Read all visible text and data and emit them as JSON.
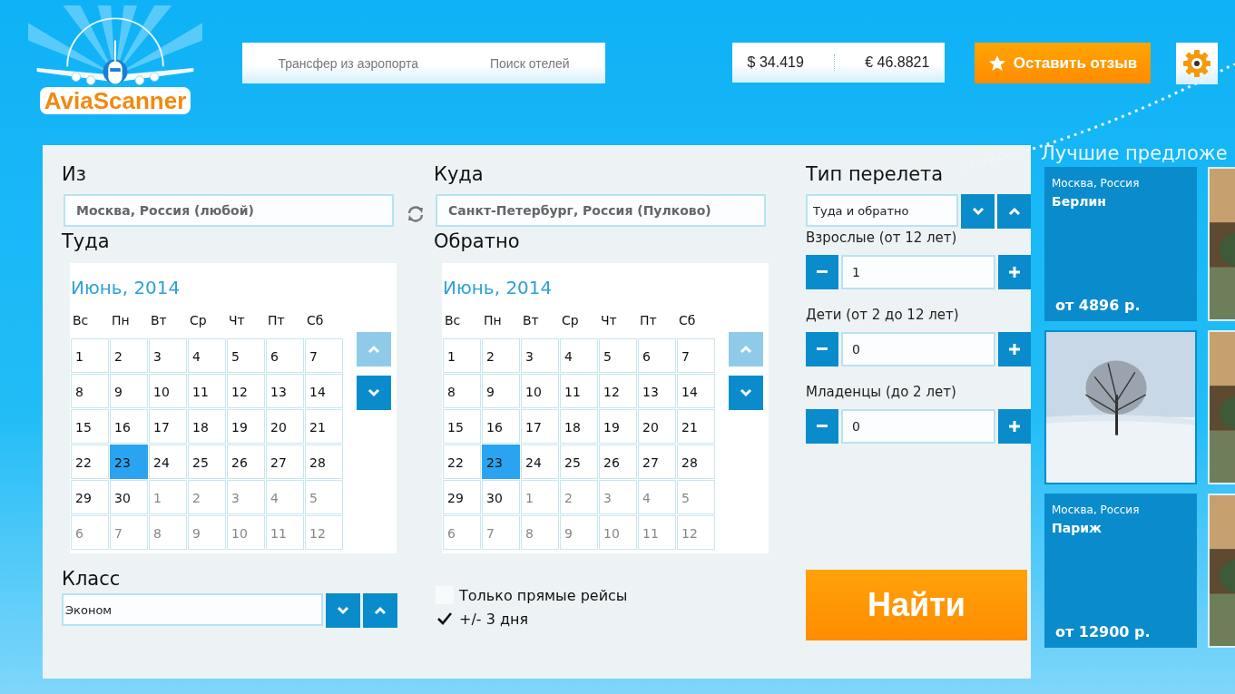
{
  "logo": {
    "text": "AviaScanner"
  },
  "nav_links": [
    "Трансфер из аэропорта",
    "Поиск отелей"
  ],
  "rates": [
    "$ 34.419",
    "€ 46.8821"
  ],
  "feedback_button": "Оставить отзыв",
  "form": {
    "from": {
      "label": "Из",
      "value": "Москва, Россия (любой)"
    },
    "to": {
      "label": "Куда",
      "value": "Санкт-Петербург, Россия (Пулково)"
    },
    "calendars": [
      {
        "label": "Туда",
        "month": "Июнь, 2014",
        "weekdays": [
          "Вс",
          "Пн",
          "Вт",
          "Ср",
          "Чт",
          "Пт",
          "Сб"
        ],
        "up_disabled": true,
        "down_disabled": false,
        "days": [
          {
            "day": "1",
            "muted": false,
            "selected": false
          },
          {
            "day": "2",
            "muted": false,
            "selected": false
          },
          {
            "day": "3",
            "muted": false,
            "selected": false
          },
          {
            "day": "4",
            "muted": false,
            "selected": false
          },
          {
            "day": "5",
            "muted": false,
            "selected": false
          },
          {
            "day": "6",
            "muted": false,
            "selected": false
          },
          {
            "day": "7",
            "muted": false,
            "selected": false
          },
          {
            "day": "8",
            "muted": false,
            "selected": false
          },
          {
            "day": "9",
            "muted": false,
            "selected": false
          },
          {
            "day": "10",
            "muted": false,
            "selected": false
          },
          {
            "day": "11",
            "muted": false,
            "selected": false
          },
          {
            "day": "12",
            "muted": false,
            "selected": false
          },
          {
            "day": "13",
            "muted": false,
            "selected": false
          },
          {
            "day": "14",
            "muted": false,
            "selected": false
          },
          {
            "day": "15",
            "muted": false,
            "selected": false
          },
          {
            "day": "16",
            "muted": false,
            "selected": false
          },
          {
            "day": "17",
            "muted": false,
            "selected": false
          },
          {
            "day": "18",
            "muted": false,
            "selected": false
          },
          {
            "day": "19",
            "muted": false,
            "selected": false
          },
          {
            "day": "20",
            "muted": false,
            "selected": false
          },
          {
            "day": "21",
            "muted": false,
            "selected": false
          },
          {
            "day": "22",
            "muted": false,
            "selected": false
          },
          {
            "day": "23",
            "muted": false,
            "selected": true
          },
          {
            "day": "24",
            "muted": false,
            "selected": false
          },
          {
            "day": "25",
            "muted": false,
            "selected": false
          },
          {
            "day": "26",
            "muted": false,
            "selected": false
          },
          {
            "day": "27",
            "muted": false,
            "selected": false
          },
          {
            "day": "28",
            "muted": false,
            "selected": false
          },
          {
            "day": "29",
            "muted": false,
            "selected": false
          },
          {
            "day": "30",
            "muted": false,
            "selected": false
          },
          {
            "day": "1",
            "muted": true,
            "selected": false
          },
          {
            "day": "2",
            "muted": true,
            "selected": false
          },
          {
            "day": "3",
            "muted": true,
            "selected": false
          },
          {
            "day": "4",
            "muted": true,
            "selected": false
          },
          {
            "day": "5",
            "muted": true,
            "selected": false
          },
          {
            "day": "6",
            "muted": true,
            "selected": false
          },
          {
            "day": "7",
            "muted": true,
            "selected": false
          },
          {
            "day": "8",
            "muted": true,
            "selected": false
          },
          {
            "day": "9",
            "muted": true,
            "selected": false
          },
          {
            "day": "10",
            "muted": true,
            "selected": false
          },
          {
            "day": "11",
            "muted": true,
            "selected": false
          },
          {
            "day": "12",
            "muted": true,
            "selected": false
          }
        ]
      },
      {
        "label": "Обратно",
        "month": "Июнь, 2014",
        "weekdays": [
          "Вс",
          "Пн",
          "Вт",
          "Ср",
          "Чт",
          "Пт",
          "Сб"
        ],
        "up_disabled": true,
        "down_disabled": false,
        "days": [
          {
            "day": "1",
            "muted": false,
            "selected": false
          },
          {
            "day": "2",
            "muted": false,
            "selected": false
          },
          {
            "day": "3",
            "muted": false,
            "selected": false
          },
          {
            "day": "4",
            "muted": false,
            "selected": false
          },
          {
            "day": "5",
            "muted": false,
            "selected": false
          },
          {
            "day": "6",
            "muted": false,
            "selected": false
          },
          {
            "day": "7",
            "muted": false,
            "selected": false
          },
          {
            "day": "8",
            "muted": false,
            "selected": false
          },
          {
            "day": "9",
            "muted": false,
            "selected": false
          },
          {
            "day": "10",
            "muted": false,
            "selected": false
          },
          {
            "day": "11",
            "muted": false,
            "selected": false
          },
          {
            "day": "12",
            "muted": false,
            "selected": false
          },
          {
            "day": "13",
            "muted": false,
            "selected": false
          },
          {
            "day": "14",
            "muted": false,
            "selected": false
          },
          {
            "day": "15",
            "muted": false,
            "selected": false
          },
          {
            "day": "16",
            "muted": false,
            "selected": false
          },
          {
            "day": "17",
            "muted": false,
            "selected": false
          },
          {
            "day": "18",
            "muted": false,
            "selected": false
          },
          {
            "day": "19",
            "muted": false,
            "selected": false
          },
          {
            "day": "20",
            "muted": false,
            "selected": false
          },
          {
            "day": "21",
            "muted": false,
            "selected": false
          },
          {
            "day": "22",
            "muted": false,
            "selected": false
          },
          {
            "day": "23",
            "muted": false,
            "selected": true
          },
          {
            "day": "24",
            "muted": false,
            "selected": false
          },
          {
            "day": "25",
            "muted": false,
            "selected": false
          },
          {
            "day": "26",
            "muted": false,
            "selected": false
          },
          {
            "day": "27",
            "muted": false,
            "selected": false
          },
          {
            "day": "28",
            "muted": false,
            "selected": false
          },
          {
            "day": "29",
            "muted": false,
            "selected": false
          },
          {
            "day": "30",
            "muted": false,
            "selected": false
          },
          {
            "day": "1",
            "muted": true,
            "selected": false
          },
          {
            "day": "2",
            "muted": true,
            "selected": false
          },
          {
            "day": "3",
            "muted": true,
            "selected": false
          },
          {
            "day": "4",
            "muted": true,
            "selected": false
          },
          {
            "day": "5",
            "muted": true,
            "selected": false
          },
          {
            "day": "6",
            "muted": true,
            "selected": false
          },
          {
            "day": "7",
            "muted": true,
            "selected": false
          },
          {
            "day": "8",
            "muted": true,
            "selected": false
          },
          {
            "day": "9",
            "muted": true,
            "selected": false
          },
          {
            "day": "10",
            "muted": true,
            "selected": false
          },
          {
            "day": "11",
            "muted": true,
            "selected": false
          },
          {
            "day": "12",
            "muted": true,
            "selected": false
          }
        ]
      }
    ],
    "class": {
      "label": "Класс",
      "value": "Эконом"
    },
    "options": [
      {
        "label": "Только прямые рейсы",
        "checked": false
      },
      {
        "label": "+/- 3 дня",
        "checked": true
      }
    ],
    "trip_type": {
      "label": "Тип перелета",
      "value": "Туда и обратно"
    },
    "passengers": [
      {
        "label": "Взрослые (от 12 лет)",
        "value": "1"
      },
      {
        "label": "Дети (от 2 до 12 лет)",
        "value": "0"
      },
      {
        "label": "Младенцы (до 2 лет)",
        "value": "0"
      }
    ],
    "search_button": "Найти"
  },
  "offers": {
    "title": "Лучшие предложе",
    "tiles": [
      {
        "kind": "deal",
        "from": "Москва, Россия",
        "city": "Берлин",
        "price": "от 4896 р."
      },
      {
        "kind": "picture",
        "selected": false
      },
      {
        "kind": "picture",
        "selected": true
      },
      {
        "kind": "picture",
        "selected": false
      },
      {
        "kind": "deal",
        "from": "Москва, Россия",
        "city": "Париж",
        "price": "от 12900 р."
      },
      {
        "kind": "picture",
        "selected": false
      }
    ]
  }
}
